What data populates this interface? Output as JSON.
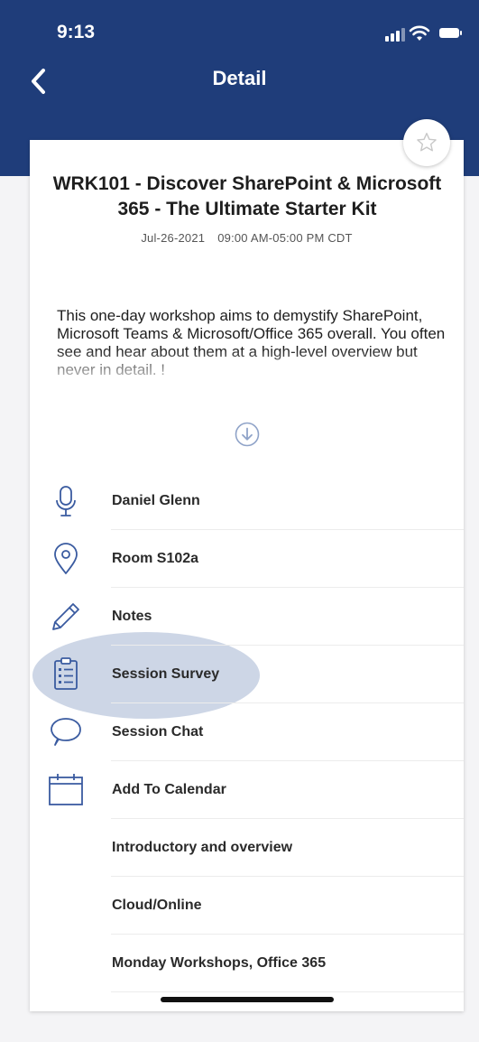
{
  "status_bar": {
    "time": "9:13"
  },
  "nav": {
    "title": "Detail"
  },
  "session": {
    "title": "WRK101 - Discover SharePoint & Microsoft 365 - The Ultimate Starter Kit",
    "date": "Jul-26-2021",
    "time": "09:00 AM-05:00 PM CDT",
    "description": "This one-day workshop aims to demystify SharePoint, Microsoft Teams & Microsoft/Office 365 overall. You often see and hear about them at a high-level overview but never in detail. !"
  },
  "details": [
    {
      "icon": "microphone-icon",
      "label": "Daniel Glenn"
    },
    {
      "icon": "location-pin-icon",
      "label": "Room S102a"
    },
    {
      "icon": "pencil-icon",
      "label": "Notes"
    },
    {
      "icon": "clipboard-icon",
      "label": "Session Survey"
    },
    {
      "icon": "chat-bubble-icon",
      "label": "Session Chat"
    },
    {
      "icon": "calendar-icon",
      "label": "Add To Calendar"
    },
    {
      "icon": "",
      "label": "Introductory and overview"
    },
    {
      "icon": "",
      "label": "Cloud/Online"
    },
    {
      "icon": "",
      "label": "Monday Workshops, Office 365"
    }
  ],
  "colors": {
    "header": "#1f3d7a",
    "icon": "#3a5ba0",
    "highlight": "#c4cfe2"
  }
}
